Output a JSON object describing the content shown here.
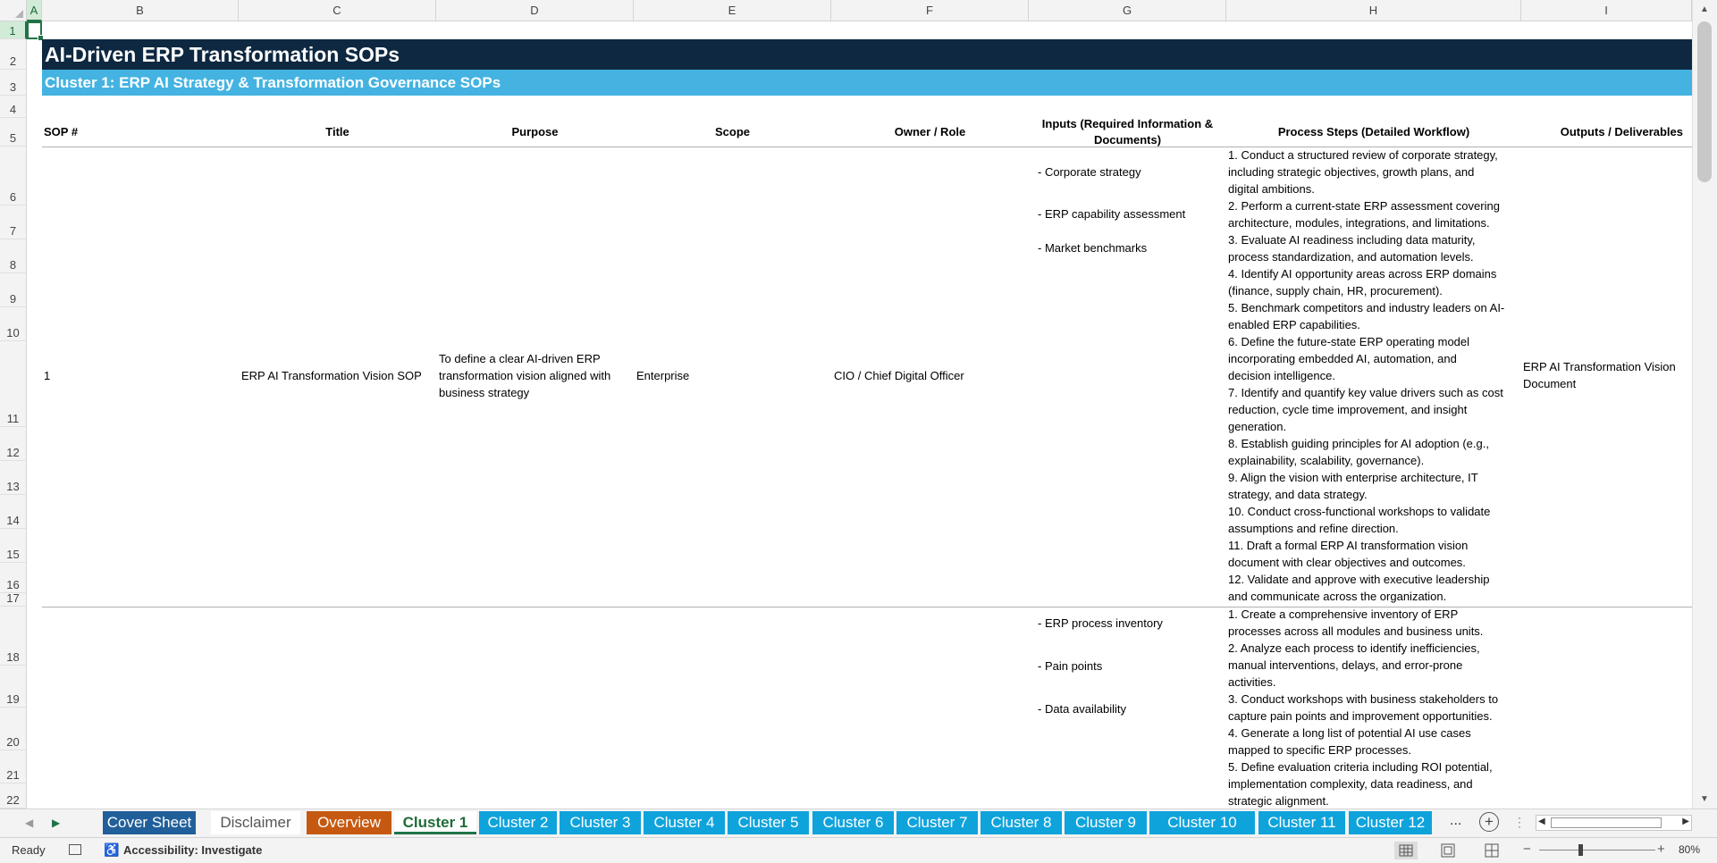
{
  "columns": [
    "A",
    "B",
    "C",
    "D",
    "E",
    "F",
    "G",
    "H",
    "I"
  ],
  "rows": [
    "1",
    "2",
    "3",
    "4",
    "5",
    "6",
    "7",
    "8",
    "9",
    "10",
    "11",
    "12",
    "13",
    "14",
    "15",
    "16",
    "17",
    "18",
    "19",
    "20",
    "21",
    "22"
  ],
  "sheet": {
    "title": "AI-Driven ERP Transformation SOPs",
    "cluster_title": "Cluster 1: ERP AI Strategy & Transformation Governance SOPs",
    "headers": {
      "sop": "SOP #",
      "title": "Title",
      "purpose": "Purpose",
      "scope": "Scope",
      "owner": "Owner / Role",
      "inputs": "Inputs (Required Information & Documents)",
      "steps": "Process Steps (Detailed Workflow)",
      "outputs": "Outputs / Deliverables"
    },
    "sop1": {
      "number": "1",
      "title": "ERP AI Transformation Vision SOP",
      "purpose": "To define a clear AI-driven ERP transformation vision aligned with business strategy",
      "scope": "Enterprise",
      "owner": "CIO / Chief Digital Officer",
      "inputs": [
        "- Corporate strategy",
        "- ERP capability assessment",
        "- Market benchmarks"
      ],
      "steps": [
        "1. Conduct a structured review of corporate strategy,",
        "including strategic objectives, growth plans, and",
        "digital ambitions.",
        "2. Perform a current-state ERP assessment covering",
        "architecture, modules, integrations, and limitations.",
        "3. Evaluate AI readiness including data maturity,",
        "process standardization, and automation levels.",
        "4. Identify AI opportunity areas across ERP domains",
        "(finance, supply chain, HR, procurement).",
        "5. Benchmark competitors and industry leaders on AI-",
        "enabled ERP capabilities.",
        "6. Define the future-state ERP operating model",
        "incorporating embedded AI, automation, and",
        "decision intelligence.",
        "7. Identify and quantify key value drivers such as cost",
        "reduction, cycle time improvement, and insight",
        "generation.",
        "8. Establish guiding principles for AI adoption (e.g.,",
        "explainability, scalability, governance).",
        "9. Align the vision with enterprise architecture, IT",
        "strategy, and data strategy.",
        "10. Conduct cross-functional workshops to validate",
        "assumptions and refine direction.",
        "11. Draft a formal ERP AI transformation vision",
        "document with clear objectives and outcomes.",
        "12. Validate and approve with executive leadership",
        "and communicate across the organization."
      ],
      "outputs": [
        "ERP AI Transformation Vision",
        "Document"
      ]
    },
    "sop2": {
      "inputs": [
        "- ERP process inventory",
        "- Pain points",
        "- Data availability"
      ],
      "steps": [
        "1. Create a comprehensive inventory of ERP",
        "processes across all modules and business units.",
        "2. Analyze each process to identify inefficiencies,",
        "manual interventions, delays, and error-prone",
        "activities.",
        "3. Conduct workshops with business stakeholders to",
        "capture pain points and improvement opportunities.",
        "4. Generate a long list of potential AI use cases",
        "mapped to specific ERP processes.",
        "5. Define evaluation criteria including ROI potential,",
        "implementation complexity, data readiness, and",
        "strategic alignment."
      ]
    }
  },
  "tabs": [
    {
      "label": "Cover Sheet",
      "color": "#215f9a"
    },
    {
      "label": "Disclaimer",
      "color": "#ffffff"
    },
    {
      "label": "Overview",
      "color": "#c65911"
    },
    {
      "label": "Cluster 1",
      "color": "#ffffff"
    },
    {
      "label": "Cluster 2",
      "color": "#0fa3dc"
    },
    {
      "label": "Cluster 3",
      "color": "#0fa3dc"
    },
    {
      "label": "Cluster 4",
      "color": "#0fa3dc"
    },
    {
      "label": "Cluster 5",
      "color": "#0fa3dc"
    },
    {
      "label": "Cluster 6",
      "color": "#0fa3dc"
    },
    {
      "label": "Cluster 7",
      "color": "#0fa3dc"
    },
    {
      "label": "Cluster 8",
      "color": "#0fa3dc"
    },
    {
      "label": "Cluster 9",
      "color": "#0fa3dc"
    },
    {
      "label": "Cluster 10",
      "color": "#0fa3dc"
    },
    {
      "label": "Cluster 11",
      "color": "#0fa3dc"
    },
    {
      "label": "Cluster 12",
      "color": "#0fa3dc"
    }
  ],
  "tab_more": "...",
  "status": {
    "ready": "Ready",
    "accessibility": "Accessibility: Investigate",
    "zoom": "80%"
  },
  "colors": {
    "title_band": "#0e2841",
    "cluster_band": "#44b3e1",
    "selection": "#217346"
  }
}
